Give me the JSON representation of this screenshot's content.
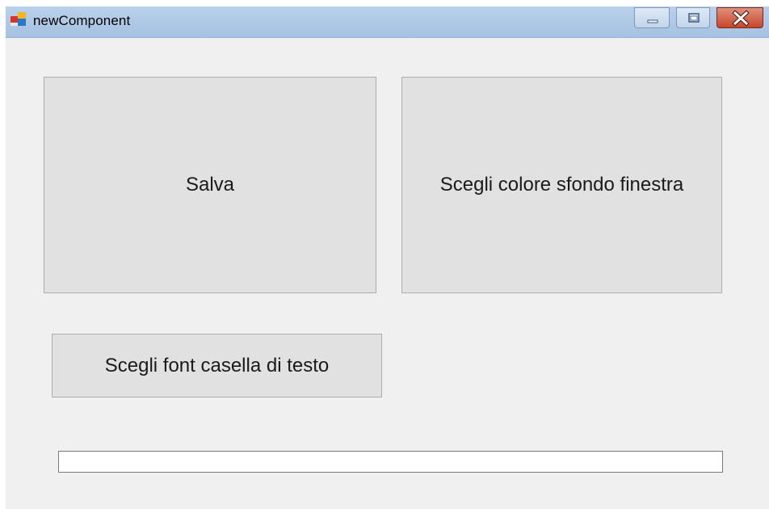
{
  "window": {
    "title": "newComponent",
    "icon": "windows-forms-app-icon",
    "controls": {
      "minimize": "minimize-icon",
      "maximize": "maximize-icon",
      "close": "close-icon"
    }
  },
  "form": {
    "save_button_label": "Salva",
    "choose_bg_color_button_label": "Scegli colore sfondo finestra",
    "choose_font_button_label": "Scegli font casella di testo",
    "text_field_value": ""
  },
  "colors": {
    "titlebar": "#b9d1ea",
    "form_background": "#f0f0f0",
    "button_face": "#e1e1e1",
    "close_button": "#c7452a"
  }
}
